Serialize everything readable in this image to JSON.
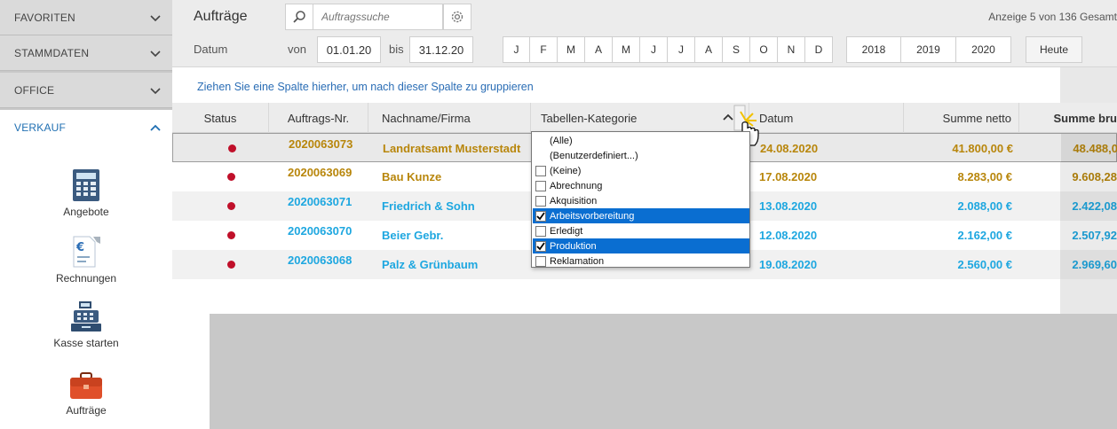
{
  "sidebar": {
    "sections": [
      {
        "label": "FAVORITEN"
      },
      {
        "label": "STAMMDATEN"
      },
      {
        "label": "OFFICE"
      },
      {
        "label": "VERKAUF"
      }
    ],
    "tiles": [
      {
        "label": "Angebote",
        "icon": "calculator-icon"
      },
      {
        "label": "Rechnungen",
        "icon": "invoice-icon"
      },
      {
        "label": "Kasse starten",
        "icon": "cash-register-icon"
      },
      {
        "label": "Aufträge",
        "icon": "briefcase-icon"
      }
    ]
  },
  "header": {
    "title": "Aufträge",
    "search_placeholder": "Auftragssuche",
    "count": "Anzeige 5 von 136 Gesamt",
    "date_label": "Datum",
    "from_label": "von",
    "from_value": "01.01.20",
    "to_label": "bis",
    "to_value": "31.12.20",
    "months": [
      "J",
      "F",
      "M",
      "A",
      "M",
      "J",
      "J",
      "A",
      "S",
      "O",
      "N",
      "D"
    ],
    "years": [
      "2018",
      "2019",
      "2020"
    ],
    "today_label": "Heute"
  },
  "group_hint": "Ziehen Sie eine Spalte hierher, um nach dieser Spalte zu gruppieren",
  "table": {
    "columns": [
      "Status",
      "Auftrags-Nr.",
      "Nachname/Firma",
      "Tabellen-Kategorie",
      "Datum",
      "Summe netto",
      "Summe bru"
    ],
    "rows": [
      {
        "nr": "2020063073",
        "name": "Landratsamt Musterstadt",
        "datum": "24.08.2020",
        "netto": "41.800,00 €",
        "brutto": "48.488,0",
        "color": "gold"
      },
      {
        "nr": "2020063069",
        "name": "Bau Kunze",
        "datum": "17.08.2020",
        "netto": "8.283,00 €",
        "brutto": "9.608,28",
        "color": "gold"
      },
      {
        "nr": "2020063071",
        "name": "Friedrich & Sohn",
        "datum": "13.08.2020",
        "netto": "2.088,00 €",
        "brutto": "2.422,08",
        "color": "blue"
      },
      {
        "nr": "2020063070",
        "name": "Beier Gebr.",
        "datum": "12.08.2020",
        "netto": "2.162,00 €",
        "brutto": "2.507,92",
        "color": "blue"
      },
      {
        "nr": "2020063068",
        "name": "Palz & Grünbaum",
        "datum": "19.08.2020",
        "netto": "2.560,00 €",
        "brutto": "2.969,60",
        "color": "blue"
      }
    ]
  },
  "dropdown": {
    "items": [
      {
        "label": "(Alle)",
        "checkbox": false,
        "checked": false,
        "selected": false
      },
      {
        "label": "(Benutzerdefiniert...)",
        "checkbox": false,
        "checked": false,
        "selected": false
      },
      {
        "label": "(Keine)",
        "checkbox": true,
        "checked": false,
        "selected": false
      },
      {
        "label": "Abrechnung",
        "checkbox": true,
        "checked": false,
        "selected": false
      },
      {
        "label": "Akquisition",
        "checkbox": true,
        "checked": false,
        "selected": false
      },
      {
        "label": "Arbeitsvorbereitung",
        "checkbox": true,
        "checked": true,
        "selected": true
      },
      {
        "label": "Erledigt",
        "checkbox": true,
        "checked": false,
        "selected": false
      },
      {
        "label": "Produktion",
        "checkbox": true,
        "checked": true,
        "selected": true
      },
      {
        "label": "Reklamation",
        "checkbox": true,
        "checked": false,
        "selected": false
      }
    ]
  },
  "colors": {
    "accent": "#1f6fb2",
    "gold_text": "#b8860b",
    "blue_text": "#1ea7e0",
    "status_dot": "#c0102a",
    "selection": "#0a6ed1"
  }
}
